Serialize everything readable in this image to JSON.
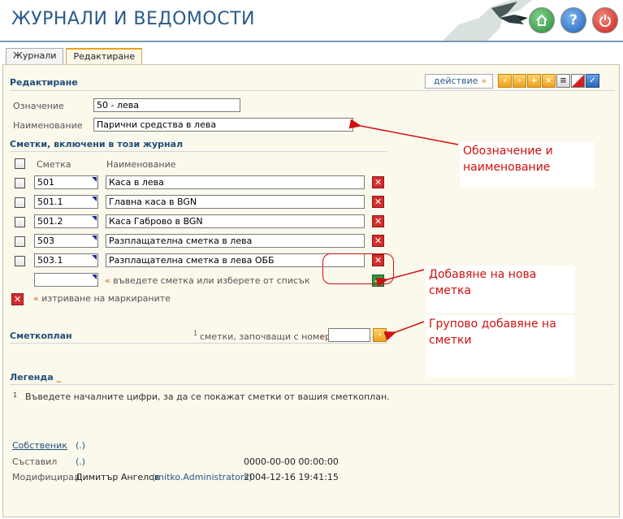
{
  "header": {
    "title": "ЖУРНАЛИ И ВЕДОМОСТИ"
  },
  "tabs": [
    {
      "label": "Журнали",
      "active": false
    },
    {
      "label": "Редактиране",
      "active": true
    }
  ],
  "edit": {
    "title": "Редактиране",
    "action_label": "действие",
    "code_label": "Означение",
    "code_value": "50 - лева",
    "name_label": "Наименование",
    "name_value": "Парични средства в лева"
  },
  "accounts": {
    "title": "Сметки, включени в този журнал",
    "col_account": "Сметка",
    "col_name": "Наименование",
    "rows": [
      {
        "account": "501",
        "name": "Каса в лева"
      },
      {
        "account": "501.1",
        "name": "Главна каса в BGN"
      },
      {
        "account": "501.2",
        "name": "Каса Габрово в BGN"
      },
      {
        "account": "503",
        "name": "Разплащателна сметка в лева"
      },
      {
        "account": "503.1",
        "name": "Разплащателна сметка в лева ОББ"
      }
    ],
    "new_hint": "въведете сметка или изберете от списък",
    "delete_marked": "изтриване на маркираните"
  },
  "chart_of_accounts": {
    "title": "Сметкоплан",
    "footnote_mark": "1",
    "prefix_label": "сметки, започващи с номера",
    "prefix_value": ""
  },
  "legend": {
    "title": "Легенда",
    "underscore": "_",
    "number": "1",
    "text": "Въведете началните цифри, за да се покажат сметки от вашия сметкоплан."
  },
  "meta": {
    "owner_label": "Собственик",
    "owner_value": "(.)",
    "created_label": "Съставил",
    "created_value": "(.)",
    "created_time": "0000-00-00 00:00:00",
    "modified_label": "Модифицирал",
    "modified_name": "Димитър Ангелов",
    "modified_user": "(mitko.Administrators)",
    "modified_time": "2004-12-16 19:41:15"
  },
  "annotations": {
    "a1_line1": "Обозначение и",
    "a1_line2": "наименование",
    "a2_line1": "Добавяне на нова",
    "a2_line2": "сметка",
    "a3_line1": "Групово добавяне на",
    "a3_line2": "сметки"
  }
}
